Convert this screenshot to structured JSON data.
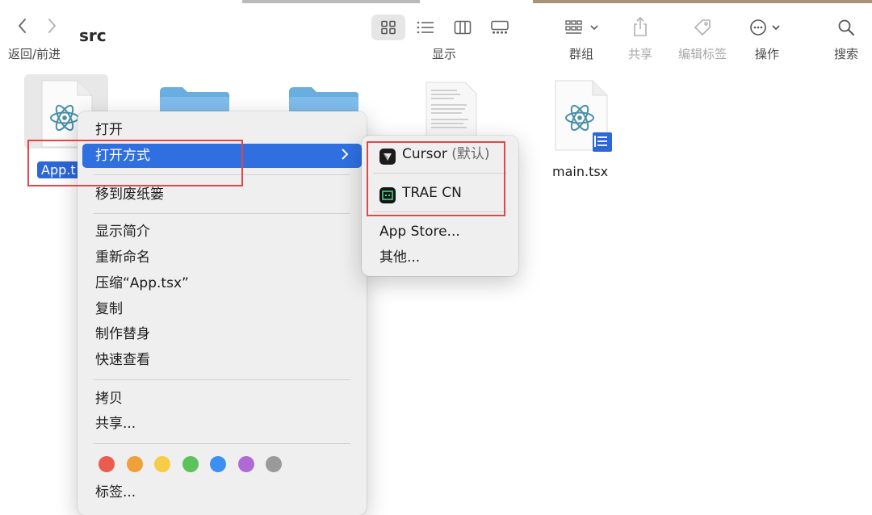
{
  "toolbar": {
    "nav_label": "返回/前进",
    "folder_title": "src",
    "view_label": "显示",
    "group_label": "群组",
    "share_label": "共享",
    "tags_label": "编辑标签",
    "actions_label": "操作",
    "search_label": "搜索"
  },
  "files": {
    "app_name_partial": "App.t",
    "main_name": "main.tsx"
  },
  "context_menu": {
    "items": [
      {
        "label": "打开"
      },
      {
        "label": "打开方式"
      },
      {
        "label": "移到废纸篓"
      },
      {
        "label": "显示简介"
      },
      {
        "label": "重新命名"
      },
      {
        "label": "压缩“App.tsx”"
      },
      {
        "label": "复制"
      },
      {
        "label": "制作替身"
      },
      {
        "label": "快速查看"
      },
      {
        "label": "拷贝"
      },
      {
        "label": "共享..."
      },
      {
        "label": "标签..."
      }
    ],
    "tag_colors": [
      "#ec5b4f",
      "#f0a03a",
      "#f6cc48",
      "#5cc25a",
      "#3d8ff2",
      "#b06ad6",
      "#9a9a9a"
    ]
  },
  "submenu": {
    "cursor_label": "Cursor",
    "cursor_default": "(默认)",
    "trae_label": "TRAE CN",
    "appstore_label": "App Store...",
    "other_label": "其他..."
  }
}
